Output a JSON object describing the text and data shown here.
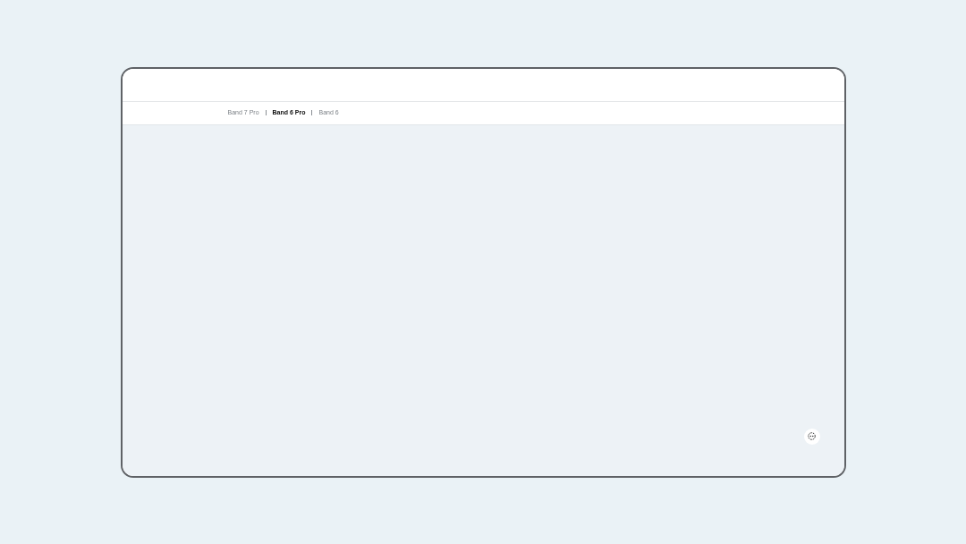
{
  "subnav": {
    "tabs": [
      {
        "label": "Band 7 Pro",
        "selected": false
      },
      {
        "label": "Band 6 Pro",
        "selected": true
      },
      {
        "label": "Band 6",
        "selected": false
      }
    ]
  }
}
